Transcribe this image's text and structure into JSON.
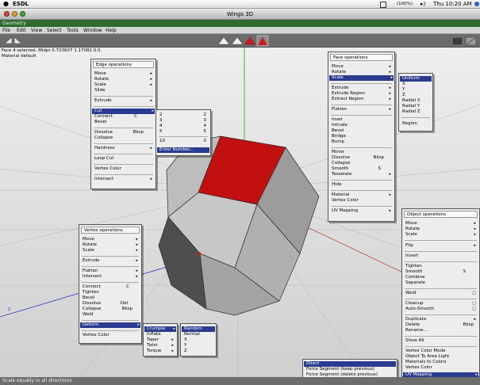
{
  "mac_menubar": {
    "app_name": "ESDL",
    "battery": "(100%)",
    "time": "Thu 10:20 AM"
  },
  "window": {
    "title": "Wings 3D",
    "geometry_label": "Geometry"
  },
  "menubar": [
    "File",
    "Edit",
    "View",
    "Select",
    "Tools",
    "Window",
    "Help"
  ],
  "info": {
    "line1": "Face 4 selected. Midpt 0.723607 1.17082 0.0.",
    "line2": "Material default"
  },
  "status": {
    "text": "Scale equally in all directions"
  },
  "colors": {
    "selection": "#c21010",
    "highlight": "#2a3c8f",
    "status_bg": "#6d6d6d"
  },
  "edge_menu": {
    "title": "Edge operations",
    "items": [
      "Move",
      "Rotate",
      "Scale",
      "Slide",
      "Extrude",
      "Cut",
      "Connect",
      "Bevel",
      "Dissolve",
      "Collapse",
      "Hardness",
      "Loop Cut",
      "Vertex Color",
      "Intersect"
    ],
    "connect_shortcut": "C",
    "dissolve_shortcut": "Bksp"
  },
  "cut_submenu": {
    "items": [
      "2",
      "3",
      "4",
      "5",
      "10"
    ],
    "values": [
      "2",
      "3",
      "4",
      "5",
      "0"
    ],
    "enter": "Enter Number..."
  },
  "face_menu": {
    "title": "Face operations",
    "items": [
      "Move",
      "Rotate",
      "Scale",
      "Extrude",
      "Extrude Region",
      "Extract Region",
      "Flatten",
      "Inset",
      "Intrude",
      "Bevel",
      "Bridge",
      "Bump",
      "Mirror",
      "Dissolve",
      "Collapse",
      "Smooth",
      "Tesselate",
      "Hide",
      "Material",
      "Vertex Color",
      "UV Mapping"
    ],
    "dissolve_shortcut": "Bksp",
    "smooth_shortcut": "S"
  },
  "scale_submenu": [
    "Uniform",
    "X",
    "Y",
    "Z",
    "Radial X",
    "Radial Y",
    "Radial Z",
    "Region"
  ],
  "vertex_menu": {
    "title": "Vertex operations",
    "items": [
      "Move",
      "Rotate",
      "Scale",
      "Extrude",
      "Flatten",
      "Intersect",
      "Connect",
      "Tighten",
      "Bevel",
      "Dissolve",
      "Collapse",
      "Weld",
      "Deform",
      "Vertex Color"
    ],
    "connect_shortcut": "C",
    "dissolve_shortcut": "Del",
    "collapse_shortcut": "Bksp"
  },
  "deform_submenu": [
    "Crumple",
    "Inflate",
    "Taper",
    "Twist",
    "Torque"
  ],
  "crumple_submenu": [
    "Random",
    "Normal",
    "X",
    "Y",
    "Z"
  ],
  "object_menu": {
    "title": "Object operations",
    "items": [
      "Move",
      "Rotate",
      "Scale",
      "Flip",
      "Invert",
      "Tighten",
      "Smooth",
      "Combine",
      "Separate",
      "Weld",
      "Cleanup",
      "Auto-Smooth",
      "Duplicate",
      "Delete",
      "Rename...",
      "Show All",
      "Vertex Color Mode",
      "Object To Area Light",
      "Materials to Colors",
      "Vertex Color",
      "UV Mapping"
    ],
    "smooth_shortcut": "S",
    "delete_shortcut": "Bksp"
  },
  "uv_submenu": [
    "Direct",
    "Force Segment (keep previous)",
    "Force Segment (delete previous)"
  ]
}
